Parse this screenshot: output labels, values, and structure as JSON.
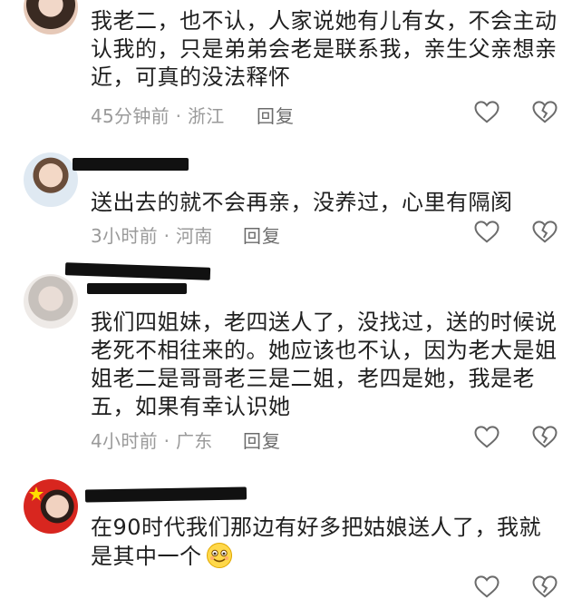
{
  "comments": [
    {
      "text": "我老二，也不认，人家说她有儿有女，不会主动认我的，只是弟弟会老是联系我，亲生父亲想亲近，可真的没法释怀",
      "time": "45分钟前",
      "location": "浙江",
      "reply_label": "回复",
      "like_icon": "heart-outline-icon",
      "dislike_icon": "broken-heart-icon"
    },
    {
      "text": "送出去的就不会再亲，没养过，心里有隔阂",
      "time": "3小时前",
      "location": "河南",
      "reply_label": "回复",
      "like_icon": "heart-outline-icon",
      "dislike_icon": "broken-heart-icon"
    },
    {
      "text": "我们四姐妹，老四送人了，没找过，送的时候说老死不相往来的。她应该也不认，因为老大是姐姐老二是哥哥老三是二姐，老四是她，我是老五，如果有幸认识她",
      "time": "4小时前",
      "location": "广东",
      "reply_label": "回复",
      "like_icon": "heart-outline-icon",
      "dislike_icon": "broken-heart-icon"
    },
    {
      "text": "在90时代我们那边有好多把姑娘送人了，我就是其中一个",
      "emoji": "smiling-face-emoji",
      "like_icon": "heart-outline-icon",
      "dislike_icon": "broken-heart-icon"
    }
  ],
  "separator": "·",
  "colors": {
    "text": "#1f1f1f",
    "meta": "#9a9a9a",
    "reply": "#6b6b6b",
    "icon": "#6b6b6b"
  }
}
